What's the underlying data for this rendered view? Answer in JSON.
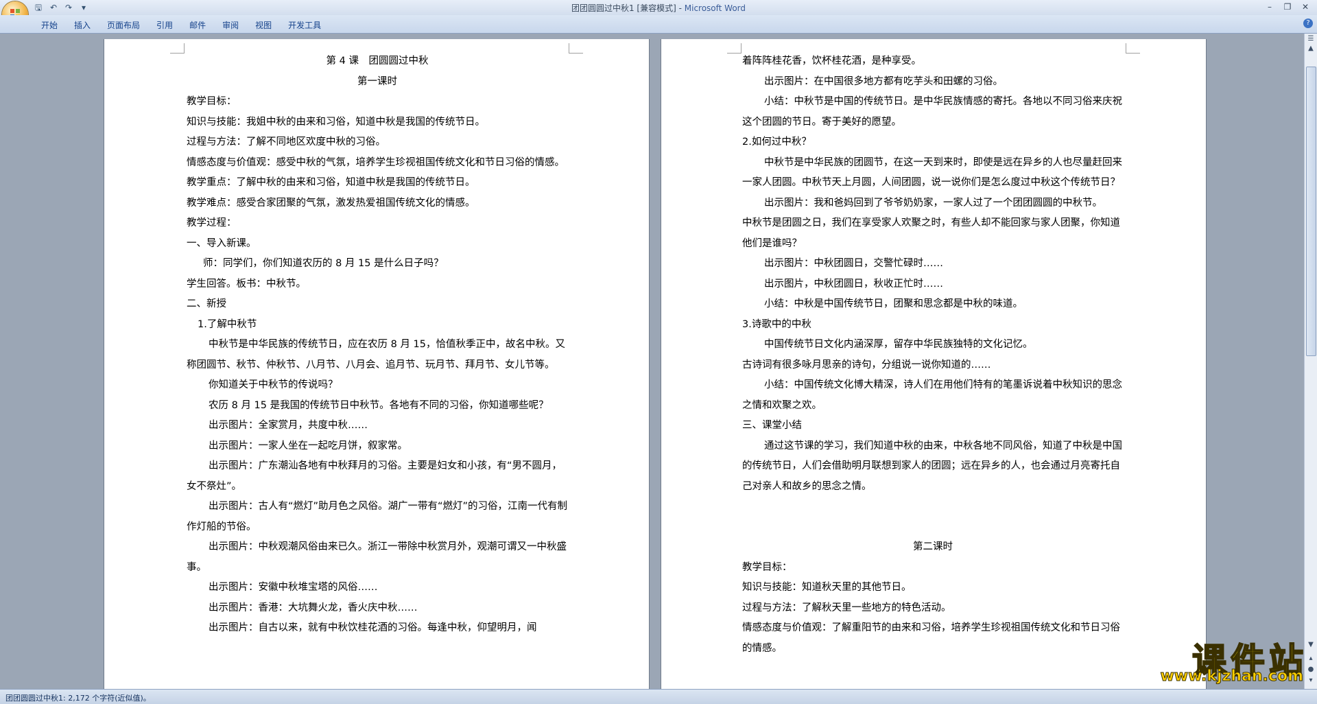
{
  "window": {
    "title": "团团圆圆过中秋1 [兼容模式] - ",
    "app_name": "Microsoft Word"
  },
  "qat": {
    "save_icon": "save-icon",
    "undo_icon": "undo-icon",
    "redo_icon": "redo-icon"
  },
  "ribbon": {
    "tabs": [
      "开始",
      "插入",
      "页面布局",
      "引用",
      "邮件",
      "审阅",
      "视图",
      "开发工具"
    ]
  },
  "page1": [
    "第 4 课　团圆圆过中秋",
    "第一课时",
    "教学目标：",
    "知识与技能：我姐中秋的由来和习俗，知道中秋是我国的传统节日。",
    "过程与方法：了解不同地区欢度中秋的习俗。",
    "情感态度与价值观：感受中秋的气氛，培养学生珍视祖国传统文化和节日习俗的情感。",
    "教学重点：了解中秋的由来和习俗，知道中秋是我国的传统节日。",
    "教学难点：感受合家团聚的气氛，激发热爱祖国传统文化的情感。",
    "教学过程：",
    "一、导入新课。",
    "师：同学们，你们知道农历的 8 月 15 是什么日子吗？",
    "学生回答。板书：中秋节。",
    "二、新授",
    "1.了解中秋节",
    "中秋节是中华民族的传统节日，应在农历 8 月 15，恰值秋季正中，故名中秋。又称团圆节、秋节、仲秋节、八月节、八月会、追月节、玩月节、拜月节、女儿节等。",
    "你知道关于中秋节的传说吗？",
    "农历 8 月 15 是我国的传统节日中秋节。各地有不同的习俗，你知道哪些呢？",
    "出示图片：全家赏月，共度中秋……",
    "出示图片：一家人坐在一起吃月饼，叙家常。",
    "出示图片：广东潮汕各地有中秋拜月的习俗。主要是妇女和小孩，有“男不圆月，女不祭灶”。",
    "出示图片：古人有“燃灯”助月色之风俗。湖广一带有“燃灯”的习俗，江南一代有制作灯船的节俗。",
    "出示图片：中秋观潮风俗由来已久。浙江一带除中秋赏月外，观潮可谓又一中秋盛事。",
    "出示图片：安徽中秋堆宝塔的风俗……",
    "出示图片：香港：大坑舞火龙，香火庆中秋……",
    "出示图片：自古以来，就有中秋饮桂花酒的习俗。每逢中秋，仰望明月，闻"
  ],
  "page2": [
    "着阵阵桂花香，饮杯桂花酒，是种享受。",
    "出示图片：在中国很多地方都有吃芋头和田螺的习俗。",
    "小结：中秋节是中国的传统节日。是中华民族情感的寄托。各地以不同习俗来庆祝这个团圆的节日。寄于美好的愿望。",
    "2.如何过中秋？",
    "中秋节是中华民族的团圆节，在这一天到来时，即使是远在异乡的人也尽量赶回来一家人团圆。中秋节天上月圆，人间团圆，说一说你们是怎么度过中秋这个传统节日？",
    "出示图片：我和爸妈回到了爷爷奶奶家，一家人过了一个团团圆圆的中秋节。",
    "中秋节是团圆之日，我们在享受家人欢聚之时，有些人却不能回家与家人团聚，你知道他们是谁吗？",
    "出示图片：中秋团圆日，交警忙碌时……",
    "出示图片，中秋团圆日，秋收正忙时……",
    "小结：中秋是中国传统节日，团聚和思念都是中秋的味道。",
    "3.诗歌中的中秋",
    "中国传统节日文化内涵深厚，留存中华民族独特的文化记忆。",
    "古诗词有很多咏月思亲的诗句，分组说一说你知道的……",
    "小结：中国传统文化博大精深，诗人们在用他们特有的笔墨诉说着中秋知识的思念之情和欢聚之欢。",
    "三、课堂小结",
    "通过这节课的学习，我们知道中秋的由来，中秋各地不同风俗，知道了中秋是中国的传统节日，人们会借助明月联想到家人的团圆；远在异乡的人，也会通过月亮寄托自己对亲人和故乡的思念之情。",
    "第二课时",
    "教学目标：",
    "知识与技能：知道秋天里的其他节日。",
    "过程与方法：了解秋天里一些地方的特色活动。",
    "情感态度与价值观：了解重阳节的由来和习俗，培养学生珍视祖国传统文化和节日习俗的情感。"
  ],
  "statusbar": {
    "text": "团团圆圆过中秋1: 2,172 个字符(近似值)。"
  },
  "watermark": {
    "brand": "课件站",
    "url": "www.kjzhan.com"
  }
}
